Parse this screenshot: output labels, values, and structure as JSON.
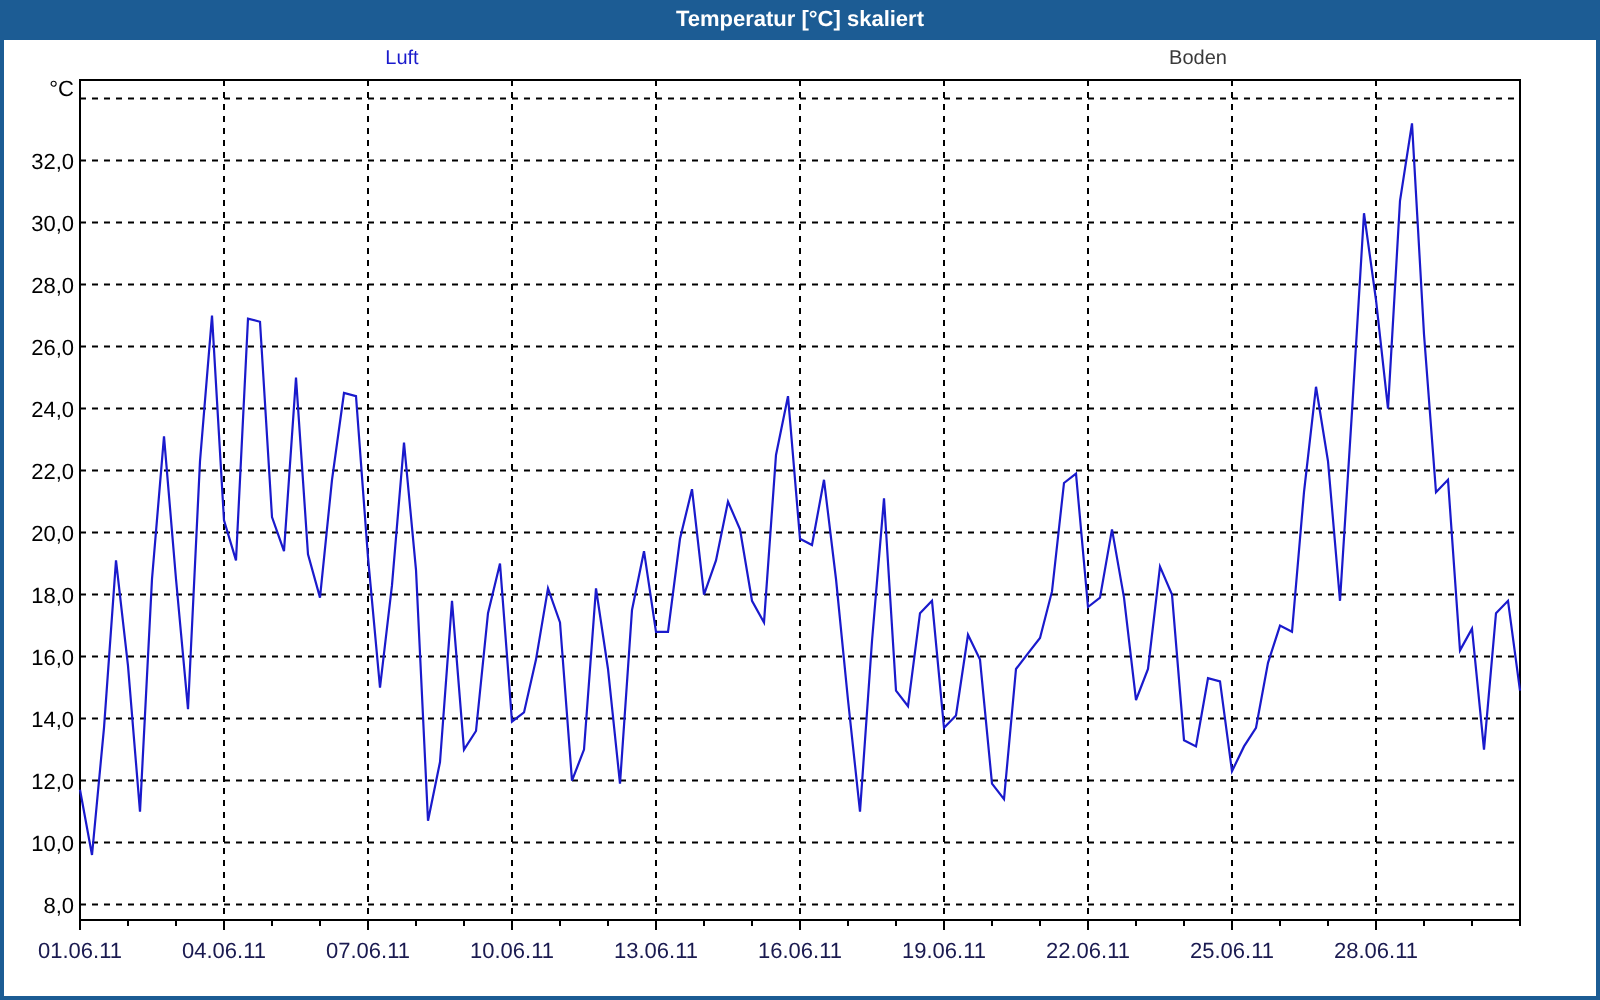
{
  "window": {
    "title": "Temperatur [°C] skaliert"
  },
  "legend": [
    {
      "label": "Boden",
      "color": "#3a3a3a"
    }
  ],
  "chart_data": {
    "type": "line",
    "grid": true,
    "ylabel": "°C",
    "ylim": [
      7.5,
      34.6
    ],
    "yticks": [
      {
        "value": 8,
        "label": "8,0"
      },
      {
        "value": 10,
        "label": "10,0"
      },
      {
        "value": 12,
        "label": "12,0"
      },
      {
        "value": 14,
        "label": "14,0"
      },
      {
        "value": 16,
        "label": "16,0"
      },
      {
        "value": 18,
        "label": "18,0"
      },
      {
        "value": 20,
        "label": "20,0"
      },
      {
        "value": 22,
        "label": "22,0"
      },
      {
        "value": 24,
        "label": "24,0"
      },
      {
        "value": 26,
        "label": "26,0"
      },
      {
        "value": 28,
        "label": "28,0"
      },
      {
        "value": 30,
        "label": "30,0"
      },
      {
        "value": 32,
        "label": "32,0"
      }
    ],
    "categories": [
      "01.06.11",
      null,
      null,
      null,
      null,
      null,
      null,
      null,
      null,
      null,
      null,
      null,
      "04.06.11",
      null,
      null,
      null,
      null,
      null,
      null,
      null,
      null,
      null,
      null,
      null,
      "07.06.11",
      null,
      null,
      null,
      null,
      null,
      null,
      null,
      null,
      null,
      null,
      null,
      "10.06.11",
      null,
      null,
      null,
      null,
      null,
      null,
      null,
      null,
      null,
      null,
      null,
      "13.06.11",
      null,
      null,
      null,
      null,
      null,
      null,
      null,
      null,
      null,
      null,
      null,
      "16.06.11",
      null,
      null,
      null,
      null,
      null,
      null,
      null,
      null,
      null,
      null,
      null,
      "19.06.11",
      null,
      null,
      null,
      null,
      null,
      null,
      null,
      null,
      null,
      null,
      null,
      "22.06.11",
      null,
      null,
      null,
      null,
      null,
      null,
      null,
      null,
      null,
      null,
      null,
      "25.06.11",
      null,
      null,
      null,
      null,
      null,
      null,
      null,
      null,
      null,
      null,
      null,
      "28.06.11",
      null,
      null,
      null,
      null,
      null,
      null,
      null,
      null,
      null,
      null,
      null,
      null
    ],
    "series": [
      {
        "name": "Luft",
        "color": "#1a1acc",
        "values": [
          11.7,
          9.6,
          13.7,
          19.1,
          15.7,
          11.0,
          18.5,
          23.1,
          18.5,
          14.3,
          22.3,
          27.0,
          20.4,
          19.1,
          26.9,
          26.8,
          20.5,
          19.4,
          25.0,
          19.3,
          17.9,
          21.7,
          24.5,
          24.4,
          19.2,
          15.0,
          18.3,
          22.9,
          18.8,
          10.7,
          12.6,
          17.8,
          13.0,
          13.6,
          17.4,
          19.0,
          13.9,
          14.2,
          15.9,
          18.2,
          17.1,
          12.0,
          13.0,
          18.2,
          15.6,
          11.9,
          17.5,
          19.4,
          16.8,
          16.8,
          19.8,
          21.4,
          18.0,
          19.1,
          21.0,
          20.1,
          17.8,
          17.1,
          22.5,
          24.4,
          19.8,
          19.6,
          21.7,
          18.5,
          14.6,
          11.0,
          16.5,
          21.1,
          14.9,
          14.4,
          17.4,
          17.8,
          13.7,
          14.1,
          16.7,
          15.9,
          11.9,
          11.4,
          15.6,
          16.1,
          16.6,
          18.1,
          21.6,
          21.9,
          17.6,
          17.9,
          20.1,
          17.9,
          14.6,
          15.6,
          18.9,
          18.0,
          13.3,
          13.1,
          15.3,
          15.2,
          12.3,
          13.1,
          13.7,
          15.8,
          17.0,
          16.8,
          21.3,
          24.7,
          22.3,
          17.8,
          23.9,
          30.3,
          27.5,
          24.0,
          30.7,
          33.2,
          26.4,
          21.3,
          21.7,
          16.2,
          16.9,
          13.0,
          17.4,
          17.8,
          14.9
        ]
      }
    ]
  }
}
